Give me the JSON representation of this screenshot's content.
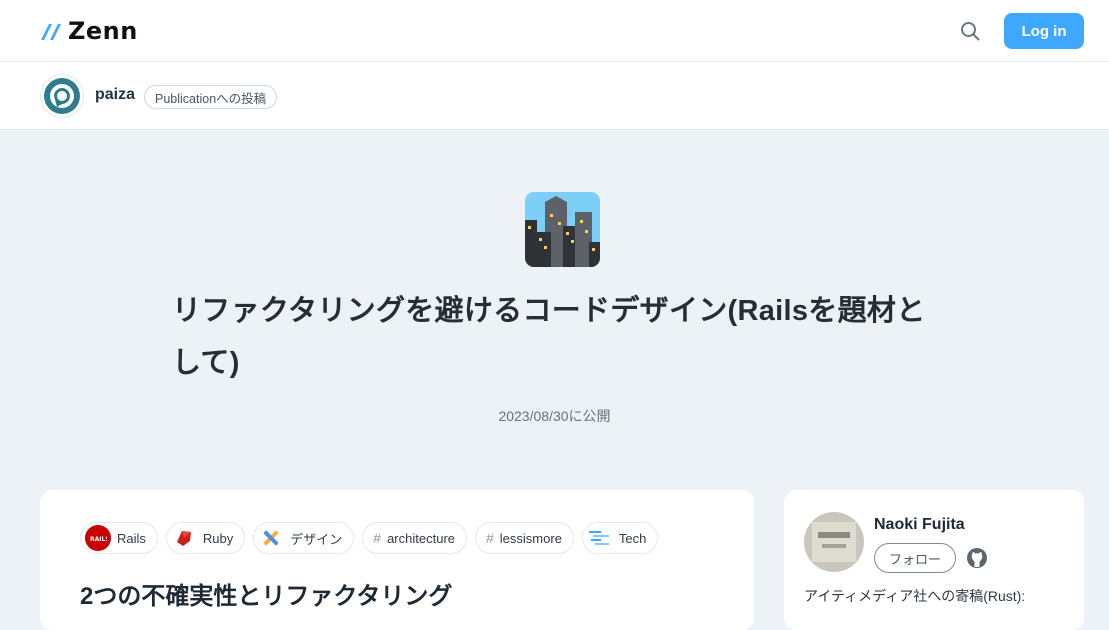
{
  "header": {
    "logo_text": "Zenn",
    "login_label": "Log in",
    "accent_color": "#3ea8ff",
    "search_icon": "search-icon"
  },
  "publication": {
    "name": "paiza",
    "badge": "Publicationへの投稿",
    "avatar_icon": "paiza-logo-icon"
  },
  "article": {
    "emoji_icon": "cityscape-icon",
    "title": "リファクタリングを避けるコードデザイン(Railsを題材として)",
    "published": "2023/08/30に公開",
    "topics": [
      {
        "label": "Rails",
        "icon": "rails-icon"
      },
      {
        "label": "Ruby",
        "icon": "ruby-icon"
      },
      {
        "label": "デザイン",
        "icon": "design-icon"
      },
      {
        "label": "architecture",
        "icon": "hash"
      },
      {
        "label": "lessismore",
        "icon": "hash"
      },
      {
        "label": "Tech",
        "icon": "tech-icon"
      }
    ],
    "first_heading": "2つの不確実性とリファクタリング"
  },
  "author": {
    "name": "Naoki Fujita",
    "follow_label": "フォロー",
    "bio": "アイティメディア社への寄稿(Rust):",
    "github_icon": "github-icon"
  }
}
